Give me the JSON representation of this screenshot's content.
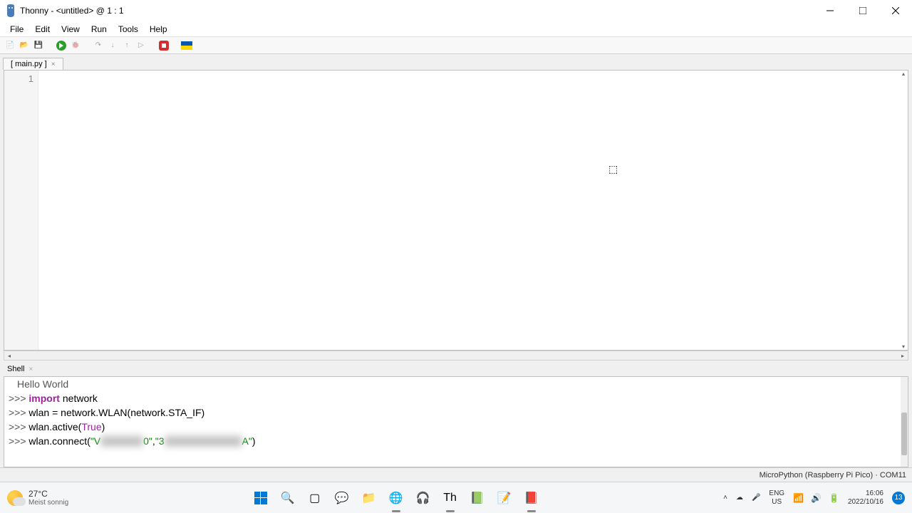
{
  "title": "Thonny  -  <untitled>  @  1 : 1",
  "menu": {
    "file": "File",
    "edit": "Edit",
    "view": "View",
    "run": "Run",
    "tools": "Tools",
    "help": "Help"
  },
  "tab": {
    "label": "[ main.py ]"
  },
  "editor": {
    "line1": "1"
  },
  "shell_label": "Shell",
  "shell": {
    "line0": "Hello World",
    "prompt": ">>> ",
    "l1_kw": "import",
    "l1_rest": " network",
    "l2": "wlan = network.WLAN(network.STA_IF)",
    "l3_a": "wlan.active(",
    "l3_true": "True",
    "l3_b": ")",
    "l4_a": "wlan.connect(",
    "l4_s1a": "\"V",
    "l4_s1blur": "xxxxxxxx",
    "l4_s1b": "0\"",
    "l4_comma": ",",
    "l4_s2a": "\"3",
    "l4_s2blur": "xxxxxxxxxxxxxxx",
    "l4_s2b": "A\"",
    "l4_c": ")"
  },
  "status": "MicroPython (Raspberry Pi Pico)  ·  COM11",
  "taskbar": {
    "temp": "27°C",
    "weather": "Meist sonnig",
    "lang1": "ENG",
    "lang2": "US",
    "time": "16:06",
    "date": "2022/10/16",
    "notif": "13"
  }
}
